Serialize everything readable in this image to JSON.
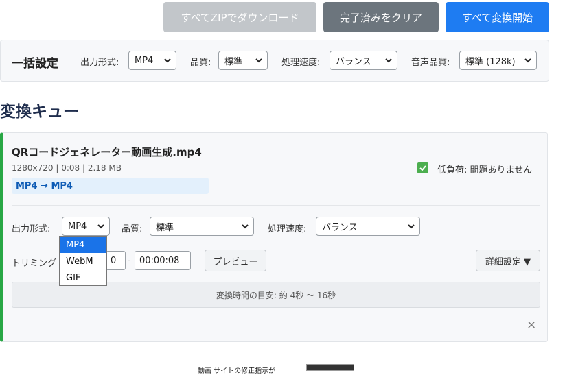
{
  "toolbar": {
    "zip_label": "すべてZIPでダウンロード",
    "clear_label": "完了済みをクリア",
    "start_label": "すべて変換開始"
  },
  "bulk": {
    "title": "一括設定",
    "format_label": "出力形式:",
    "format_value": "MP4",
    "quality_label": "品質:",
    "quality_value": "標準",
    "speed_label": "処理速度:",
    "speed_value": "バランス",
    "audio_label": "音声品質:",
    "audio_value": "標準 (128k)"
  },
  "queue": {
    "title": "変換キュー"
  },
  "item": {
    "file_name": "QRコードジェネレーター動画生成.mp4",
    "meta": "1280x720 | 0:08 | 2.18 MB",
    "format_tag": "MP4 → MP4",
    "load_status": "低負荷: 問題ありません",
    "format_label": "出力形式:",
    "format_value": "MP4",
    "quality_label": "品質:",
    "quality_value": "標準",
    "speed_label": "処理速度:",
    "speed_value": "バランス",
    "trim_label": "トリミング",
    "trim_start": "0",
    "trim_dash": "-",
    "trim_end": "00:00:08",
    "preview_label": "プレビュー",
    "advanced_label": "詳細設定 ▼",
    "estimate": "変換時間の目安: 約 4秒 〜 16秒",
    "close_symbol": "×",
    "format_options": [
      "MP4",
      "WebM",
      "GIF"
    ]
  },
  "bottom": {
    "text": "動画 サイトの修正指示が"
  },
  "colors": {
    "accent": "#1e7cf2",
    "success": "#28a745",
    "tag_text": "#0d5bb5"
  }
}
